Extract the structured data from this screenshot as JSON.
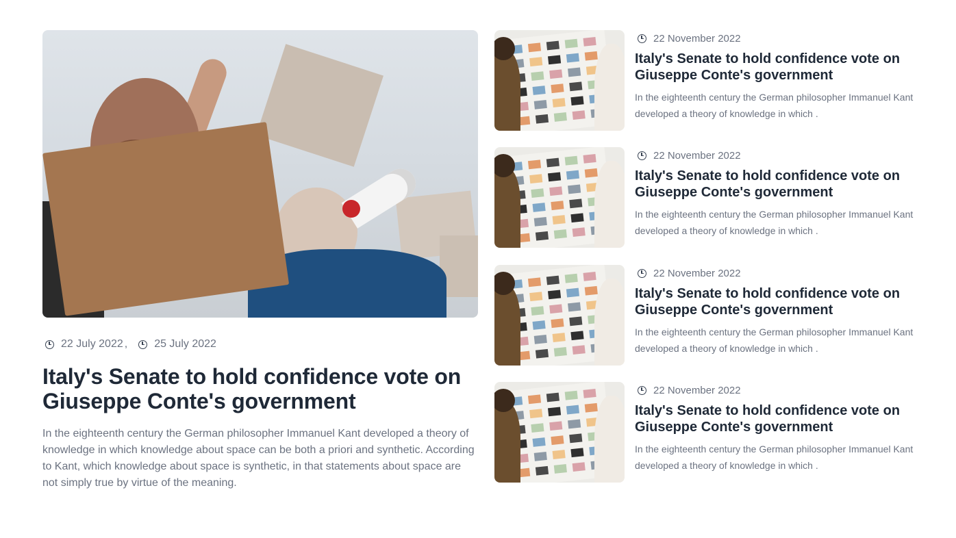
{
  "featured": {
    "image_alt": "protesters-photo",
    "dates": [
      "22 July 2022",
      "25 July 2022"
    ],
    "date_separator": ",",
    "title": "Italy's Senate to hold confidence vote on Giuseppe Conte's government",
    "excerpt": "In the eighteenth century the German philosopher Immanuel Kant developed a theory of knowledge in which knowledge about space can be both a priori and synthetic. According to Kant, which knowledge about space is synthetic, in that statements about space are not simply true by virtue of the meaning."
  },
  "articles": [
    {
      "date": "22 November 2022",
      "title": "Italy's Senate to hold confidence vote on Giuseppe Conte's government",
      "excerpt": "In the eighteenth century the German philosopher Immanuel Kant developed a theory of knowledge in which ."
    },
    {
      "date": "22 November 2022",
      "title": "Italy's Senate to hold confidence vote on Giuseppe Conte's government",
      "excerpt": "In the eighteenth century the German philosopher Immanuel Kant developed a theory of knowledge in which ."
    },
    {
      "date": "22 November 2022",
      "title": "Italy's Senate to hold confidence vote on Giuseppe Conte's government",
      "excerpt": "In the eighteenth century the German philosopher Immanuel Kant developed a theory of knowledge in which ."
    },
    {
      "date": "22 November 2022",
      "title": "Italy's Senate to hold confidence vote on Giuseppe Conte's government",
      "excerpt": "In the eighteenth century the German philosopher Immanuel Kant developed a theory of knowledge in which ."
    }
  ],
  "icons": {
    "date": "clock-icon"
  }
}
